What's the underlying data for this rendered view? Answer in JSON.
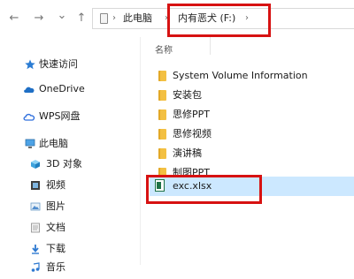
{
  "address_bar": {
    "back_glyph": "←",
    "forward_glyph": "→",
    "recent_glyph": "⌄",
    "up_glyph": "↑",
    "breadcrumbs": [
      "此电脑",
      "内有恶犬 (F:)"
    ],
    "separator": "›"
  },
  "file_list": {
    "column_header": "名称",
    "items": [
      {
        "name": "System Volume Information",
        "type": "folder"
      },
      {
        "name": "安装包",
        "type": "folder"
      },
      {
        "name": "思修PPT",
        "type": "folder"
      },
      {
        "name": "思修视频",
        "type": "folder"
      },
      {
        "name": "演讲稿",
        "type": "folder"
      },
      {
        "name": "制图PPT",
        "type": "folder"
      },
      {
        "name": "exc.xlsx",
        "type": "xlsx",
        "selected": true
      }
    ]
  },
  "sidebar": {
    "items": [
      {
        "label": "快速访问",
        "icon": "star-icon"
      },
      {
        "label": "OneDrive",
        "icon": "cloud-icon"
      },
      {
        "label": "WPS网盘",
        "icon": "wps-cloud-icon"
      },
      {
        "label": "此电脑",
        "icon": "computer-icon"
      },
      {
        "label": "3D 对象",
        "icon": "cube-icon"
      },
      {
        "label": "视频",
        "icon": "film-icon"
      },
      {
        "label": "图片",
        "icon": "picture-icon"
      },
      {
        "label": "文档",
        "icon": "document-icon"
      },
      {
        "label": "下载",
        "icon": "download-icon"
      },
      {
        "label": "音乐",
        "icon": "music-icon"
      }
    ]
  },
  "colors": {
    "highlight_red": "#d71212",
    "selection_blue": "#cce8ff",
    "folder_yellow": "#f3c042",
    "excel_green": "#1e7145"
  }
}
